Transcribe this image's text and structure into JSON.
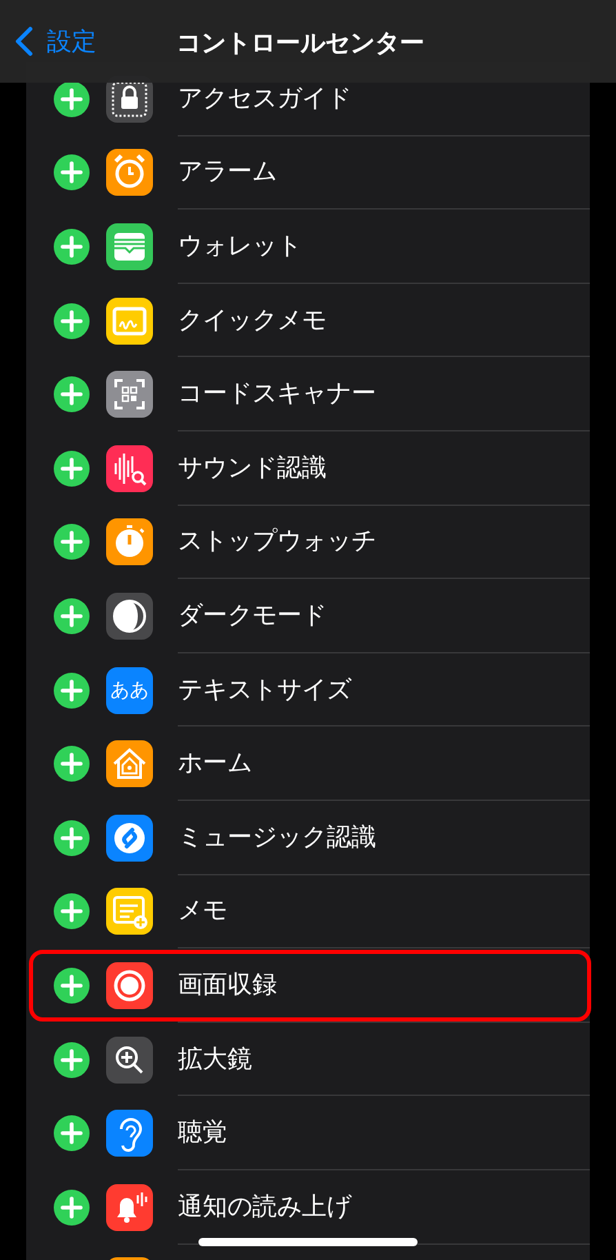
{
  "nav": {
    "back": "設定",
    "title": "コントロールセンター"
  },
  "items": [
    {
      "label": "アクセスガイド",
      "color": "#48484a",
      "highlighted": false
    },
    {
      "label": "アラーム",
      "color": "#ff9500",
      "highlighted": false
    },
    {
      "label": "ウォレット",
      "color": "#34c759",
      "highlighted": false
    },
    {
      "label": "クイックメモ",
      "color": "#ffcc00",
      "highlighted": false
    },
    {
      "label": "コードスキャナー",
      "color": "#8e8e93",
      "highlighted": false
    },
    {
      "label": "サウンド認識",
      "color": "#ff2d55",
      "highlighted": false
    },
    {
      "label": "ストップウォッチ",
      "color": "#ff9500",
      "highlighted": false
    },
    {
      "label": "ダークモード",
      "color": "#48484a",
      "highlighted": false
    },
    {
      "label": "テキストサイズ",
      "color": "#0a84ff",
      "icon_text": "ああ",
      "highlighted": false
    },
    {
      "label": "ホーム",
      "color": "#ff9500",
      "highlighted": false
    },
    {
      "label": "ミュージック認識",
      "color": "#0a84ff",
      "highlighted": false
    },
    {
      "label": "メモ",
      "color": "#ffcc00",
      "highlighted": false
    },
    {
      "label": "画面収録",
      "color": "#ff3b30",
      "highlighted": true
    },
    {
      "label": "拡大鏡",
      "color": "#48484a",
      "highlighted": false
    },
    {
      "label": "聴覚",
      "color": "#0a84ff",
      "highlighted": false
    },
    {
      "label": "通知の読み上げ",
      "color": "#ff3b30",
      "highlighted": false
    },
    {
      "color": "#ff9500",
      "highlighted": false
    }
  ]
}
